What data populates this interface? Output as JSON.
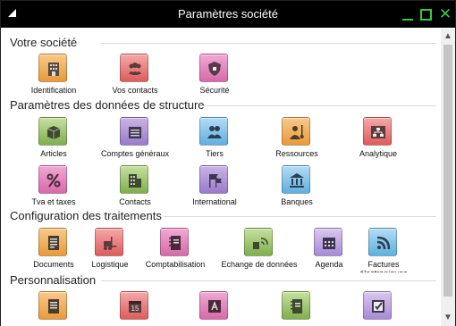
{
  "window": {
    "title": "Paramètres société"
  },
  "sections": {
    "s1": "Votre société",
    "s2": "Paramètres des données de structure",
    "s3": "Configuration des traitements",
    "s4": "Personnalisation"
  },
  "tiles": {
    "identification": {
      "label": "Identification",
      "icon": "building-icon",
      "color": "#e99a3b"
    },
    "contacts": {
      "label": "Vos contacts",
      "icon": "people-icon",
      "color": "#de5c5c"
    },
    "securite": {
      "label": "Sécurité",
      "icon": "shield-icon",
      "color": "#d66aa8"
    },
    "articles": {
      "label": "Articles",
      "icon": "box-icon",
      "color": "#7fae4f"
    },
    "comptes": {
      "label": "Comptes généraux",
      "icon": "ledger-icon",
      "color": "#9a7bc9"
    },
    "tiers": {
      "label": "Tiers",
      "icon": "people-icon",
      "color": "#5fb0e0"
    },
    "ressources": {
      "label": "Ressources",
      "icon": "worker-icon",
      "color": "#e99a3b"
    },
    "analytique": {
      "label": "Analytique",
      "icon": "org-chart-icon",
      "color": "#de5c5c"
    },
    "tva": {
      "label": "Tva et taxes",
      "icon": "percent-icon",
      "color": "#d66aa8"
    },
    "contacts2": {
      "label": "Contacts",
      "icon": "building-icon",
      "color": "#7fae4f"
    },
    "international": {
      "label": "International",
      "icon": "flags-icon",
      "color": "#9a7bc9"
    },
    "banques": {
      "label": "Banques",
      "icon": "bank-icon",
      "color": "#5fb0e0"
    },
    "documents": {
      "label": "Documents",
      "icon": "document-icon",
      "color": "#e99a3b"
    },
    "logistique": {
      "label": "Logistique",
      "icon": "forklift-icon",
      "color": "#de5c5c"
    },
    "comptabilisation": {
      "label": "Comptabilisation",
      "icon": "notebook-icon",
      "color": "#d66aa8"
    },
    "echange": {
      "label": "Echange de données",
      "icon": "network-icon",
      "color": "#7fae4f"
    },
    "agenda": {
      "label": "Agenda",
      "icon": "calendar-icon",
      "color": "#9a7bc9"
    },
    "factures": {
      "label": "Factures électroniques",
      "icon": "rss-icon",
      "color": "#5fb0e0"
    },
    "p1": {
      "label": "",
      "icon": "document-icon",
      "color": "#e99a3b"
    },
    "p2": {
      "label": "",
      "icon": "calendar-icon",
      "color": "#de5c5c",
      "day": "15"
    },
    "p3": {
      "label": "",
      "icon": "font-icon",
      "color": "#d66aa8"
    },
    "p4": {
      "label": "",
      "icon": "notebook-icon",
      "color": "#7fae4f"
    },
    "p5": {
      "label": "",
      "icon": "checkbox-icon",
      "color": "#9a7bc9"
    }
  }
}
